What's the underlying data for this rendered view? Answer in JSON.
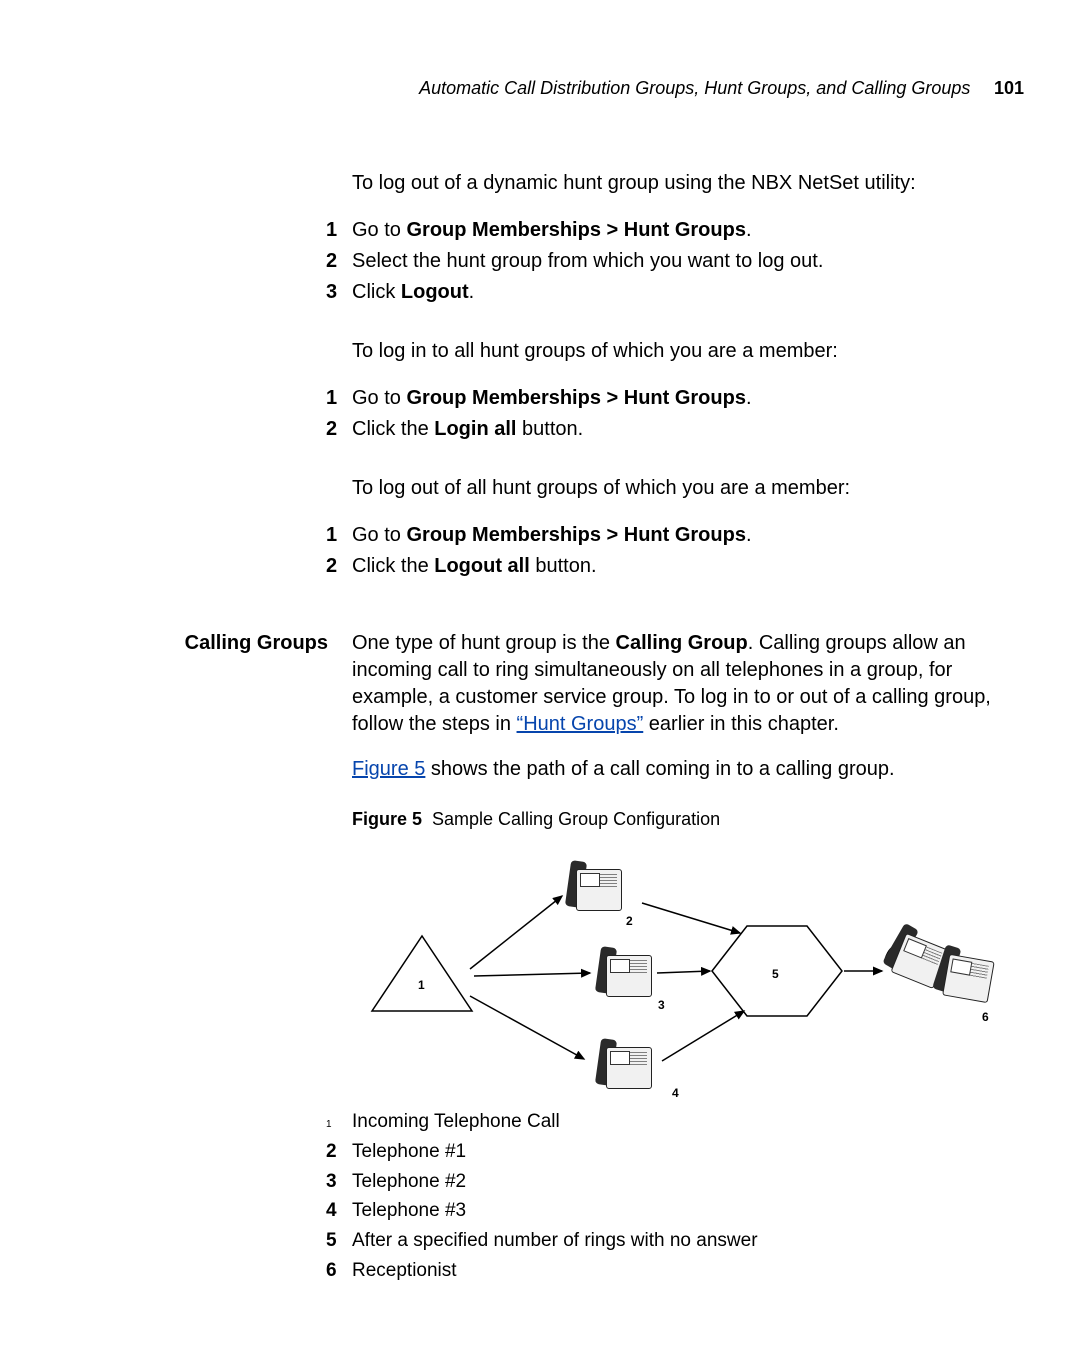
{
  "header": {
    "running_title": "Automatic Call Distribution Groups, Hunt Groups, and Calling Groups",
    "page_number": "101"
  },
  "section1": {
    "intro": "To log out of a dynamic hunt group using the NBX NetSet utility:",
    "steps": [
      {
        "num": "1",
        "pre": "Go to ",
        "bold": "Group Memberships > Hunt Groups",
        "post": "."
      },
      {
        "num": "2",
        "pre": "Select the hunt group from which you want to log out.",
        "bold": "",
        "post": ""
      },
      {
        "num": "3",
        "pre": "Click ",
        "bold": "Logout",
        "post": "."
      }
    ]
  },
  "section2": {
    "intro": "To log in to all hunt groups of which you are a member:",
    "steps": [
      {
        "num": "1",
        "pre": "Go to ",
        "bold": "Group Memberships > Hunt Groups",
        "post": "."
      },
      {
        "num": "2",
        "pre": "Click the ",
        "bold": "Login all",
        "post": " button."
      }
    ]
  },
  "section3": {
    "intro": "To log out of all hunt groups of which you are a member:",
    "steps": [
      {
        "num": "1",
        "pre": "Go to ",
        "bold": "Group Memberships > Hunt Groups",
        "post": "."
      },
      {
        "num": "2",
        "pre": "Click the ",
        "bold": "Logout all",
        "post": " button."
      }
    ]
  },
  "calling_groups": {
    "side_heading": "Calling Groups",
    "para1_pre": "One type of hunt group is the ",
    "para1_bold": "Calling Group",
    "para1_mid": ". Calling groups allow an incoming call to ring simultaneously on all telephones in a group, for example, a customer service group. To log in to or out of a calling group, follow the steps in ",
    "para1_link": "“Hunt Groups”",
    "para1_post": " earlier in this chapter.",
    "para2_link": "Figure 5",
    "para2_rest": " shows the path of a call coming in to a calling group.",
    "fig_label": "Figure 5",
    "fig_caption": "Sample Calling Group Configuration",
    "diagram_labels": {
      "l1": "1",
      "l2": "2",
      "l3": "3",
      "l4": "4",
      "l5": "5",
      "l6": "6"
    },
    "legend": [
      {
        "num": "1",
        "text": "Incoming Telephone Call"
      },
      {
        "num": "2",
        "text": "Telephone #1"
      },
      {
        "num": "3",
        "text": "Telephone #2"
      },
      {
        "num": "4",
        "text": "Telephone #3"
      },
      {
        "num": "5",
        "text": "After a specified number of rings with no answer"
      },
      {
        "num": "6",
        "text": "Receptionist"
      }
    ]
  }
}
